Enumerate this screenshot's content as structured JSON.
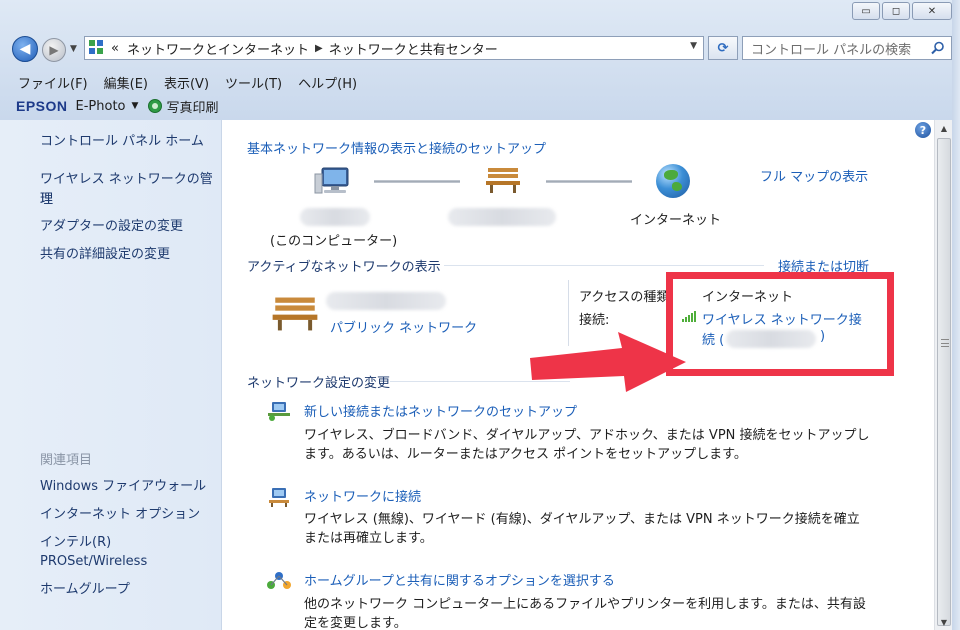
{
  "window": {
    "minimize": "▭",
    "maximize": "◻",
    "close": "✕"
  },
  "address": {
    "chevron": "«",
    "crumbs": [
      "ネットワークとインターネット",
      "ネットワークと共有センター"
    ],
    "search_placeholder": "コントロール パネルの検索"
  },
  "menu": [
    "ファイル(F)",
    "編集(E)",
    "表示(V)",
    "ツール(T)",
    "ヘルプ(H)"
  ],
  "epsonbar": {
    "logo": "EPSON",
    "app": "E-Photo",
    "print": "写真印刷"
  },
  "sidebar": {
    "items": [
      "コントロール パネル ホーム",
      "ワイヤレス ネットワークの管理",
      "アダプターの設定の変更",
      "共有の詳細設定の変更"
    ],
    "wireless_line2": "理",
    "related_heading": "関連項目",
    "related": [
      "Windows ファイアウォール",
      "インターネット オプション",
      "インテル(R)",
      "PROSet/Wireless",
      "ホームグループ"
    ]
  },
  "main": {
    "basic_title": "基本ネットワーク情報の表示と接続のセットアップ",
    "full_map": "フル マップの表示",
    "this_computer": "(このコンピューター)",
    "internet": "インターネット",
    "active_title": "アクティブなネットワークの表示",
    "connect_or_disconnect": "接続または切断",
    "public_network": "パブリック ネットワーク",
    "access_type_label": "アクセスの種類:",
    "access_type_value": "インターネット",
    "connection_label": "接続:",
    "connection_value_1": "ワイヤレス ネットワーク接",
    "connection_value_2a": "続 (",
    "connection_value_2b": ")",
    "change_title": "ネットワーク設定の変更",
    "tasks": [
      {
        "link": "新しい接続またはネットワークのセットアップ",
        "desc1": "ワイヤレス、ブロードバンド、ダイヤルアップ、アドホック、または VPN 接続をセットアップし",
        "desc2": "ます。あるいは、ルーターまたはアクセス ポイントをセットアップします。"
      },
      {
        "link": "ネットワークに接続",
        "desc1": "ワイヤレス (無線)、ワイヤード (有線)、ダイヤルアップ、または VPN ネットワーク接続を確立",
        "desc2": "または再確立します。"
      },
      {
        "link": "ホームグループと共有に関するオプションを選択する",
        "desc1": "他のネットワーク コンピューター上にあるファイルやプリンターを利用します。または、共有設",
        "desc2": "定を変更します。"
      }
    ]
  },
  "colors": {
    "annotation": "#ee3448",
    "link": "#1c5fb8"
  }
}
